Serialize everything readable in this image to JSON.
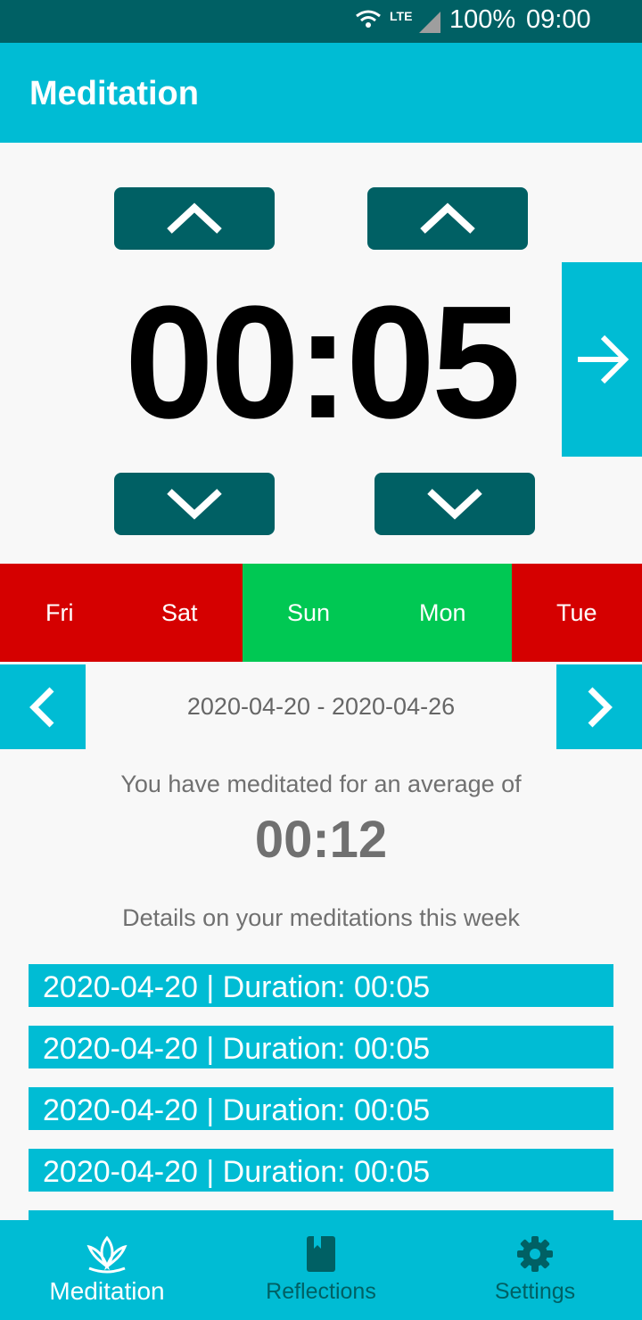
{
  "status_bar": {
    "network_type": "LTE",
    "battery": "100%",
    "time": "09:00",
    "icons": [
      "wifi-icon",
      "signal-icon"
    ]
  },
  "app_bar": {
    "title": "Meditation"
  },
  "timer": {
    "display": "00:05",
    "controls": [
      "minutes-up",
      "seconds-up",
      "minutes-down",
      "seconds-down",
      "start-arrow"
    ]
  },
  "days": [
    {
      "label": "Fri",
      "status": "missed",
      "color": "#d50000"
    },
    {
      "label": "Sat",
      "status": "missed",
      "color": "#d50000"
    },
    {
      "label": "Sun",
      "status": "meditated",
      "color": "#00c853"
    },
    {
      "label": "Mon",
      "status": "meditated",
      "color": "#00c853"
    },
    {
      "label": "Tue",
      "status": "missed",
      "color": "#d50000"
    }
  ],
  "week": {
    "range": "2020-04-20 - 2020-04-26"
  },
  "average": {
    "label": "You have meditated for an average of",
    "value": "00:12"
  },
  "details": {
    "label": "Details on your meditations this week",
    "sessions": [
      "2020-04-20 | Duration: 00:05",
      "2020-04-20 | Duration: 00:05",
      "2020-04-20 | Duration: 00:05",
      "2020-04-20 | Duration: 00:05"
    ]
  },
  "bottom_nav": {
    "items": [
      {
        "label": "Meditation",
        "icon": "lotus-icon",
        "active": true
      },
      {
        "label": "Reflections",
        "icon": "book-icon",
        "active": false
      },
      {
        "label": "Settings",
        "icon": "gear-icon",
        "active": false
      }
    ]
  },
  "colors": {
    "primary": "#00bcd4",
    "primary_dark": "#006064",
    "missed": "#d50000",
    "meditated": "#00c853"
  }
}
